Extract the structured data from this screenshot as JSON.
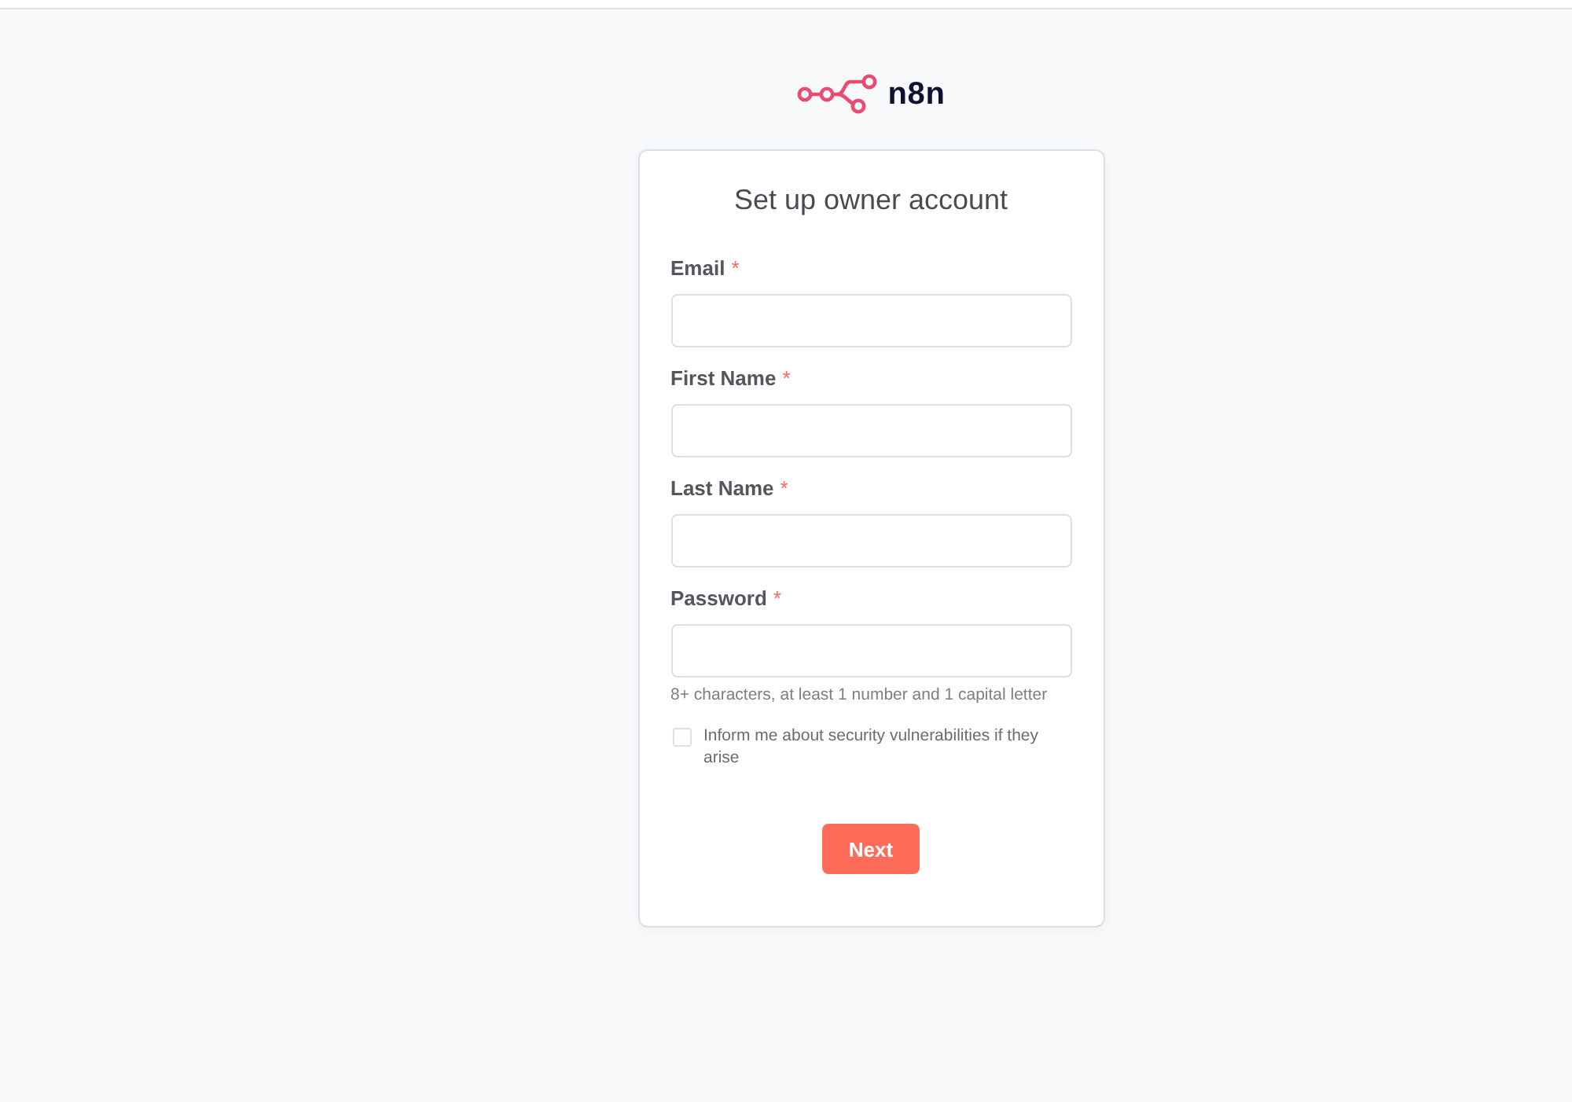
{
  "logo": {
    "text": "n8n"
  },
  "card": {
    "title": "Set up owner account",
    "fields": [
      {
        "label": "Email",
        "required_mark": "*"
      },
      {
        "label": "First Name",
        "required_mark": "*"
      },
      {
        "label": "Last Name",
        "required_mark": "*"
      },
      {
        "label": "Password",
        "required_mark": "*",
        "hint": "8+ characters, at least 1 number and 1 capital letter"
      }
    ],
    "checkbox": {
      "label": "Inform me about security vulnerabilities if they arise",
      "checked": false
    },
    "button": {
      "label": "Next"
    }
  }
}
